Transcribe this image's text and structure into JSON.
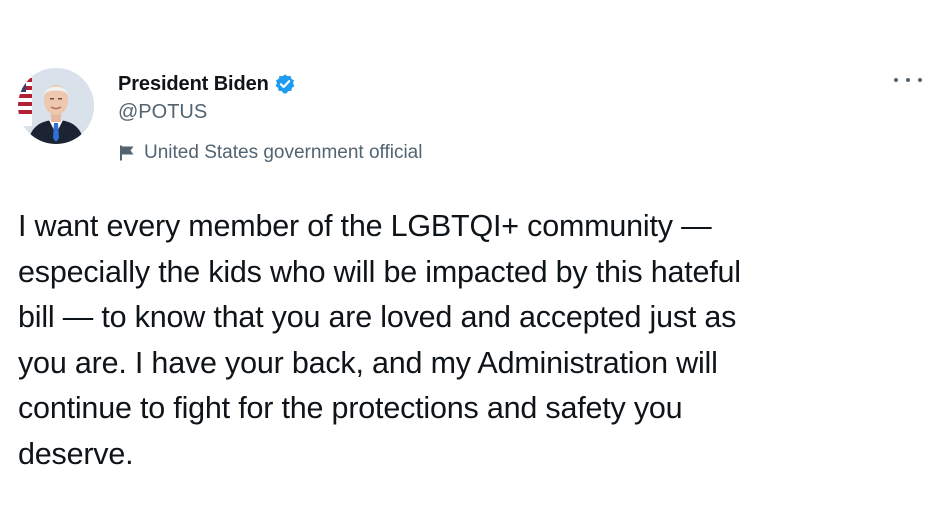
{
  "tweet": {
    "author": {
      "display_name": "President Biden",
      "handle": "@POTUS",
      "verified": true,
      "label_icon": "flag-icon",
      "label": "United States government official",
      "avatar": "avatar-photo"
    },
    "menu_icon": "more-icon",
    "text_lines": [
      "I want every member of the LGBTQI+ community —",
      "especially the kids who will be impacted by this hateful",
      "bill — to know that you are loved and accepted just as",
      "you are. I have your back, and my Administration will",
      "continue to fight for the protections and safety you",
      "deserve."
    ]
  },
  "colors": {
    "text": "#0f1419",
    "secondary": "#536471",
    "verified_badge": "#1d9bf0",
    "background": "#ffffff"
  }
}
